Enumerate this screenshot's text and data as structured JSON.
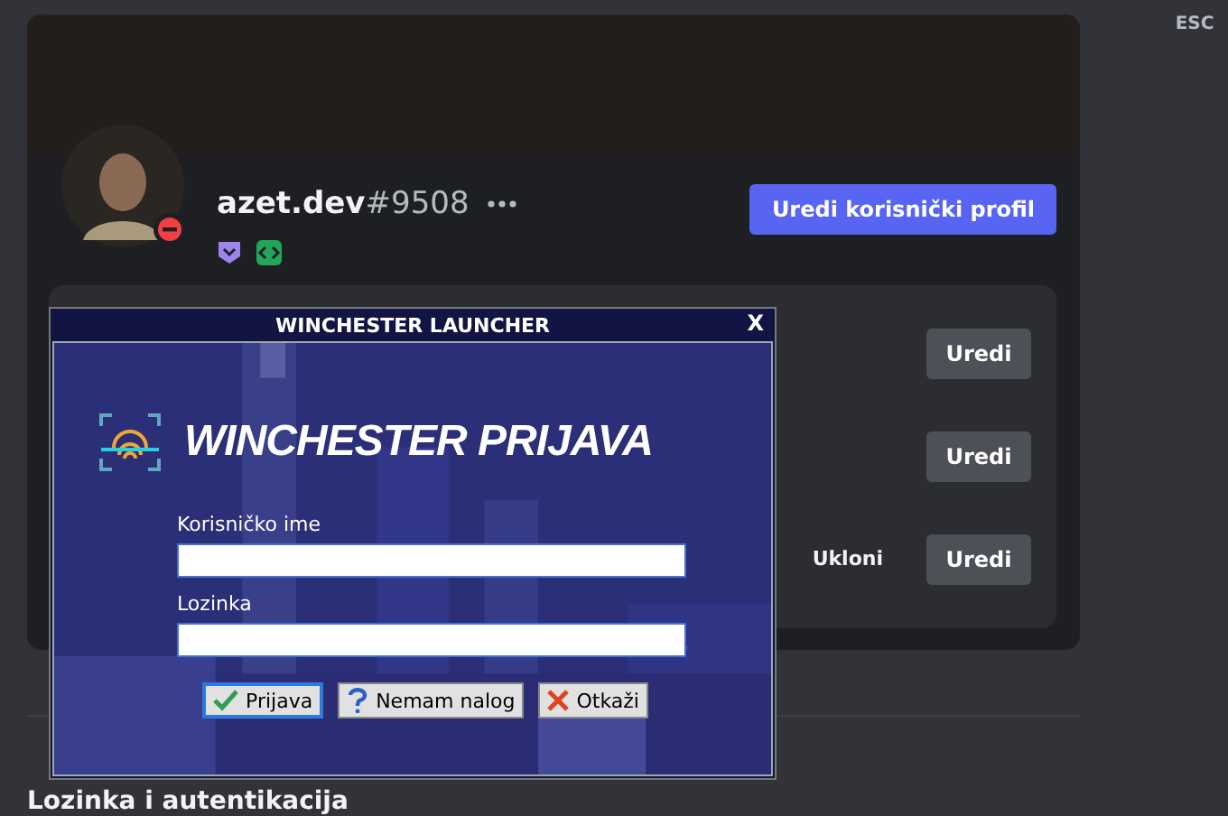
{
  "esc": "ESC",
  "profile": {
    "username": "azet.dev",
    "discriminator": "#9508",
    "edit_button": "Uredi korisnički profil"
  },
  "account_rows": [
    {
      "edit": "Uredi"
    },
    {
      "edit": "Uredi"
    },
    {
      "remove": "Ukloni",
      "edit": "Uredi"
    }
  ],
  "section_heading": "Lozinka i autentikacija",
  "dialog": {
    "title": "WINCHESTER LAUNCHER",
    "close": "X",
    "heading": "WINCHESTER PRIJAVA",
    "fields": [
      {
        "label": "Korisničko ime"
      },
      {
        "label": "Lozinka"
      }
    ],
    "buttons": [
      {
        "kind": "ok",
        "label": "Prijava",
        "selected": true
      },
      {
        "kind": "help",
        "label": "Nemam nalog",
        "selected": false
      },
      {
        "kind": "cancel",
        "label": "Otkaži",
        "selected": false
      }
    ]
  }
}
